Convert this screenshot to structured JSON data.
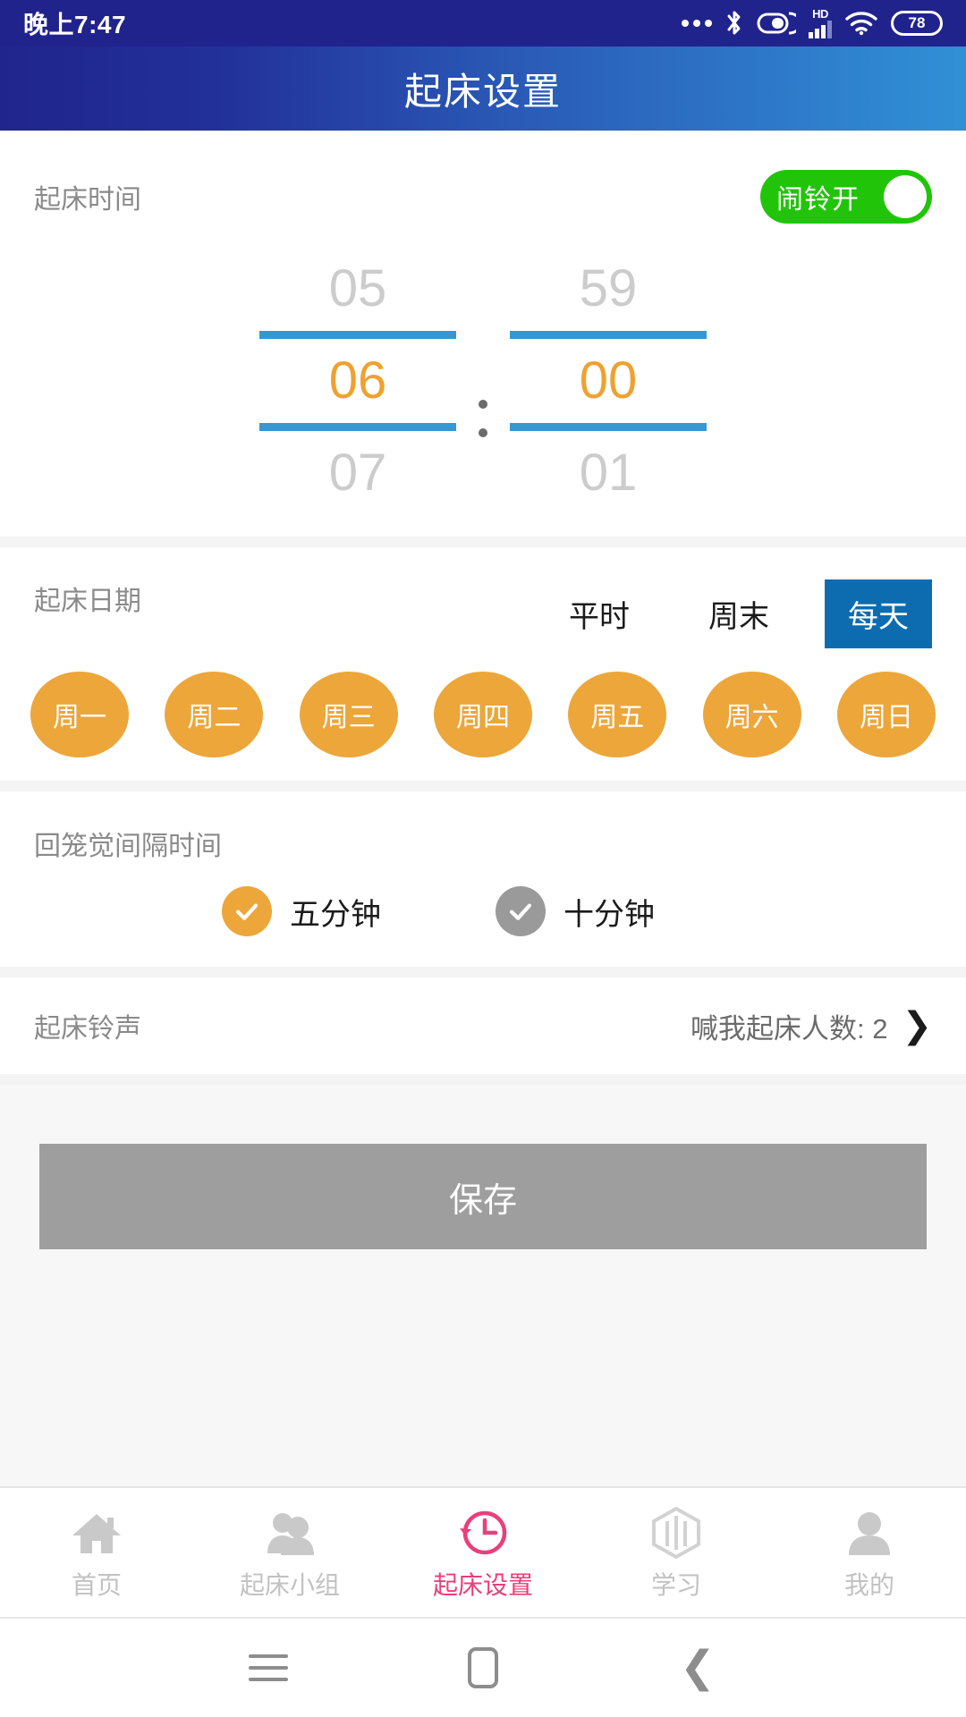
{
  "status_bar": {
    "time": "晚上7:47",
    "icons": [
      "more-dots-icon",
      "bluetooth-icon",
      "do-not-disturb-icon",
      "hd-signal-icon",
      "wifi-icon",
      "battery-icon"
    ],
    "hd_label": "HD",
    "battery_level": "78"
  },
  "header": {
    "title": "起床设置",
    "gradient_start": "#20258c",
    "gradient_end": "#3090d6",
    "status_bg": "#21238d"
  },
  "wake_time": {
    "label": "起床时间",
    "toggle": {
      "label": "闹铃开",
      "on": true,
      "color": "#22c40a"
    },
    "hour": {
      "prev": "05",
      "selected": "06",
      "next": "07"
    },
    "minute": {
      "prev": "59",
      "selected": "00",
      "next": "01"
    },
    "separator": ":",
    "selected_color": "#efa130",
    "rail_color": "#3498d4"
  },
  "wake_date": {
    "label": "起床日期",
    "modes": [
      {
        "label": "平时",
        "active": false
      },
      {
        "label": "周末",
        "active": false
      },
      {
        "label": "每天",
        "active": true
      }
    ],
    "active_color": "#0d6cb0",
    "day_color": "#eca63a",
    "days": [
      {
        "label": "周一",
        "selected": true
      },
      {
        "label": "周二",
        "selected": true
      },
      {
        "label": "周三",
        "selected": true
      },
      {
        "label": "周四",
        "selected": true
      },
      {
        "label": "周五",
        "selected": true
      },
      {
        "label": "周六",
        "selected": true
      },
      {
        "label": "周日",
        "selected": true
      }
    ]
  },
  "snooze": {
    "label": "回笼觉间隔时间",
    "options": [
      {
        "label": "五分钟",
        "selected": true,
        "color": "#eca63a"
      },
      {
        "label": "十分钟",
        "selected": false,
        "color": "#9a9a9a"
      }
    ]
  },
  "ringtone": {
    "label": "起床铃声",
    "value": "喊我起床人数: 2",
    "chevron": "❯"
  },
  "save": {
    "label": "保存",
    "color": "#9e9e9e",
    "enabled": false
  },
  "tabbar": {
    "active_color": "#ea3f7a",
    "inactive_color": "#c2c2c2",
    "items": [
      {
        "label": "首页",
        "icon": "home-icon",
        "active": false
      },
      {
        "label": "起床小组",
        "icon": "group-icon",
        "active": false
      },
      {
        "label": "起床设置",
        "icon": "clock-icon",
        "active": true
      },
      {
        "label": "学习",
        "icon": "book-icon",
        "active": false
      },
      {
        "label": "我的",
        "icon": "person-icon",
        "active": false
      }
    ]
  },
  "android_nav": {
    "menu": "menu-icon",
    "home": "home-square-icon",
    "back": "back-chevron-icon"
  }
}
